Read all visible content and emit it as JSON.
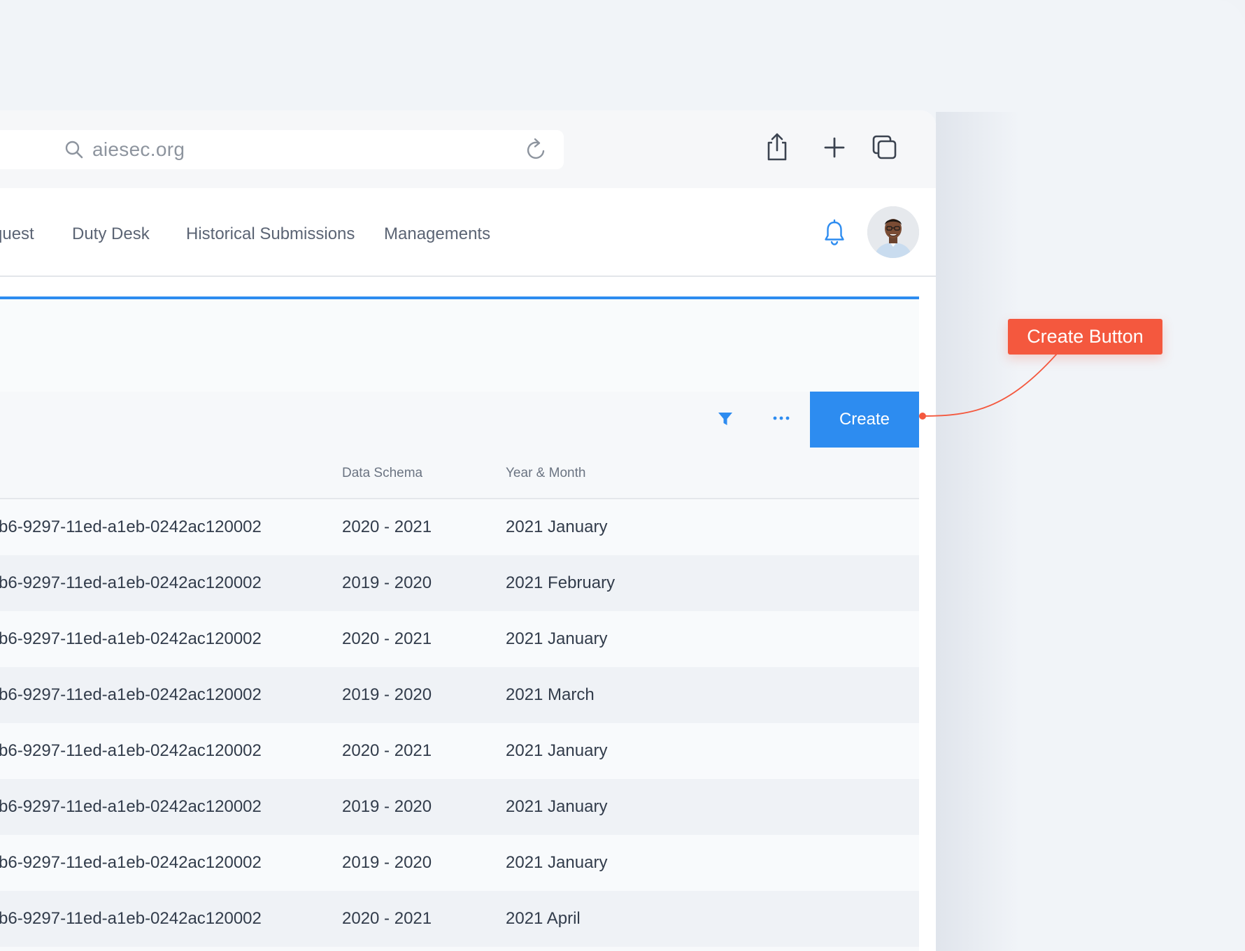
{
  "browser": {
    "url": "aiesec.org"
  },
  "nav": {
    "items": [
      "quest",
      "Duty Desk",
      "Historical Submissions",
      "Managements"
    ]
  },
  "toolbar": {
    "create_label": "Create"
  },
  "table": {
    "headers": [
      "Data Schema",
      "Year & Month"
    ],
    "rows": [
      {
        "id": "b6-9297-11ed-a1eb-0242ac120002",
        "schema": "2020 - 2021",
        "month": "2021 January"
      },
      {
        "id": "b6-9297-11ed-a1eb-0242ac120002",
        "schema": "2019 - 2020",
        "month": "2021 February"
      },
      {
        "id": "b6-9297-11ed-a1eb-0242ac120002",
        "schema": "2020 - 2021",
        "month": "2021 January"
      },
      {
        "id": "b6-9297-11ed-a1eb-0242ac120002",
        "schema": "2019 - 2020",
        "month": "2021 March"
      },
      {
        "id": "b6-9297-11ed-a1eb-0242ac120002",
        "schema": "2020 - 2021",
        "month": "2021 January"
      },
      {
        "id": "b6-9297-11ed-a1eb-0242ac120002",
        "schema": "2019 - 2020",
        "month": "2021 January"
      },
      {
        "id": "b6-9297-11ed-a1eb-0242ac120002",
        "schema": "2019 - 2020",
        "month": "2021 January"
      },
      {
        "id": "b6-9297-11ed-a1eb-0242ac120002",
        "schema": "2020 - 2021",
        "month": "2021 April"
      }
    ]
  },
  "annotation": {
    "label": "Create Button"
  },
  "colors": {
    "accent": "#2d8cf0",
    "callout": "#f4583e"
  },
  "icons": [
    "search-icon",
    "reload-icon",
    "share-icon",
    "plus-icon",
    "tabs-icon",
    "bell-icon",
    "filter-icon",
    "more-icon"
  ]
}
